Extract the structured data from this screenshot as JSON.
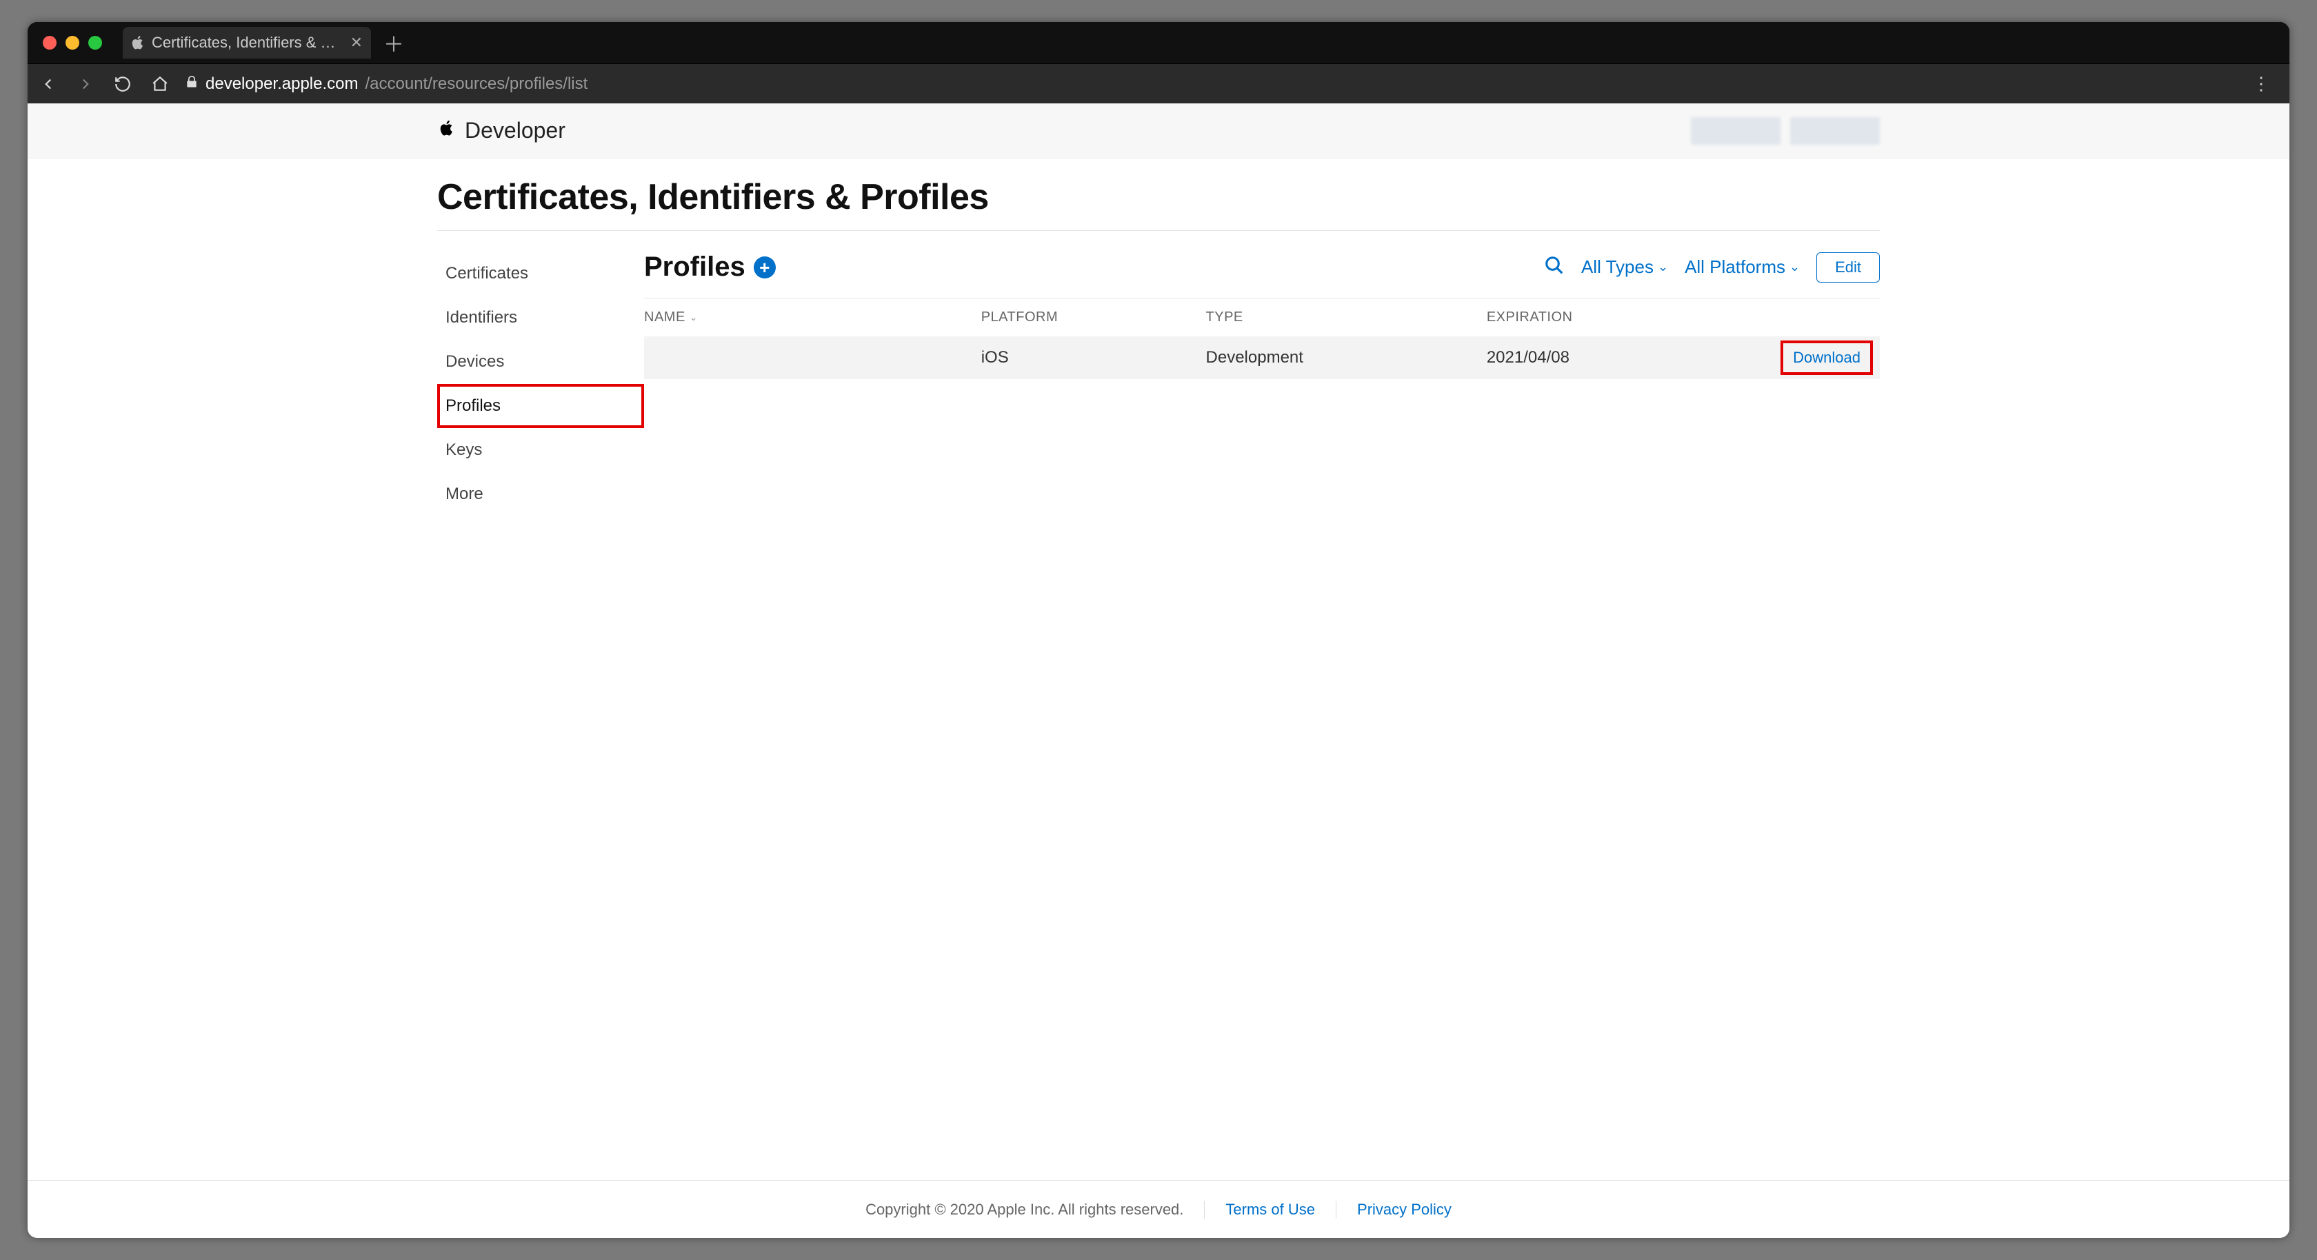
{
  "browser": {
    "tab_title": "Certificates, Identifiers & Profiles",
    "url_display_domain": "developer.apple.com",
    "url_display_path": "/account/resources/profiles/list"
  },
  "header": {
    "brand": "Developer"
  },
  "page": {
    "title": "Certificates, Identifiers & Profiles"
  },
  "sidebar": {
    "items": [
      {
        "label": "Certificates",
        "active": false
      },
      {
        "label": "Identifiers",
        "active": false
      },
      {
        "label": "Devices",
        "active": false
      },
      {
        "label": "Profiles",
        "active": true
      },
      {
        "label": "Keys",
        "active": false
      },
      {
        "label": "More",
        "active": false
      }
    ]
  },
  "section": {
    "title": "Profiles",
    "filters": {
      "types": "All Types",
      "platforms": "All Platforms"
    },
    "edit_label": "Edit"
  },
  "table": {
    "columns": {
      "name": "NAME",
      "platform": "PLATFORM",
      "type": "TYPE",
      "expiration": "EXPIRATION"
    },
    "rows": [
      {
        "platform": "iOS",
        "type": "Development",
        "expiration": "2021/04/08",
        "action": "Download"
      }
    ]
  },
  "footer": {
    "copyright": "Copyright © 2020 Apple Inc. All rights reserved.",
    "terms": "Terms of Use",
    "privacy": "Privacy Policy"
  }
}
